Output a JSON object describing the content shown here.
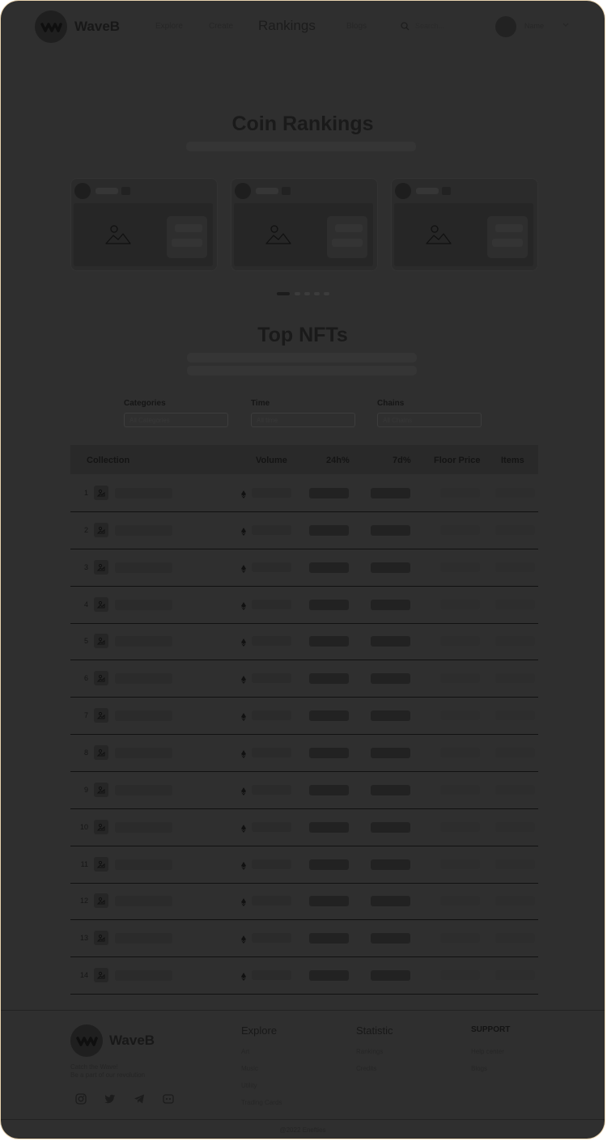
{
  "header": {
    "brand": "WaveB",
    "nav": [
      "Explore",
      "Create",
      "Rankings",
      "Blogs"
    ],
    "active_nav": "Rankings",
    "search_placeholder": "Search...",
    "user_name": "Name"
  },
  "coin_section": {
    "title": "Coin Rankings",
    "card_count": 3,
    "carousel_dots": 5,
    "active_dot": 1
  },
  "nft_section": {
    "title": "Top NFTs",
    "filters": [
      {
        "label": "Categories",
        "value": "All Categories"
      },
      {
        "label": "Time",
        "value": "All time"
      },
      {
        "label": "Chains",
        "value": "All Chains"
      }
    ],
    "columns": [
      "Collection",
      "Volume",
      "24h%",
      "7d%",
      "Floor Price",
      "Items"
    ],
    "rows": [
      "1",
      "2",
      "3",
      "4",
      "5",
      "6",
      "7",
      "8",
      "9",
      "10",
      "11",
      "12",
      "13",
      "14"
    ]
  },
  "footer": {
    "brand": "WaveB",
    "tagline_1": "Catch the Wave!",
    "tagline_2": "Be a part of our revolution",
    "social_icons": [
      "instagram-icon",
      "twitter-icon",
      "telegram-icon",
      "discord-icon"
    ],
    "columns": [
      {
        "heading": "Explore",
        "links": [
          "Art",
          "Music",
          "Utility",
          "Trading Cards"
        ]
      },
      {
        "heading": "Statistic",
        "links": [
          "Rankings",
          "Credits"
        ]
      },
      {
        "heading": "SUPPORT",
        "links": [
          "Help center",
          "Blogs"
        ]
      }
    ],
    "copyright": "@2022 Enefties"
  }
}
